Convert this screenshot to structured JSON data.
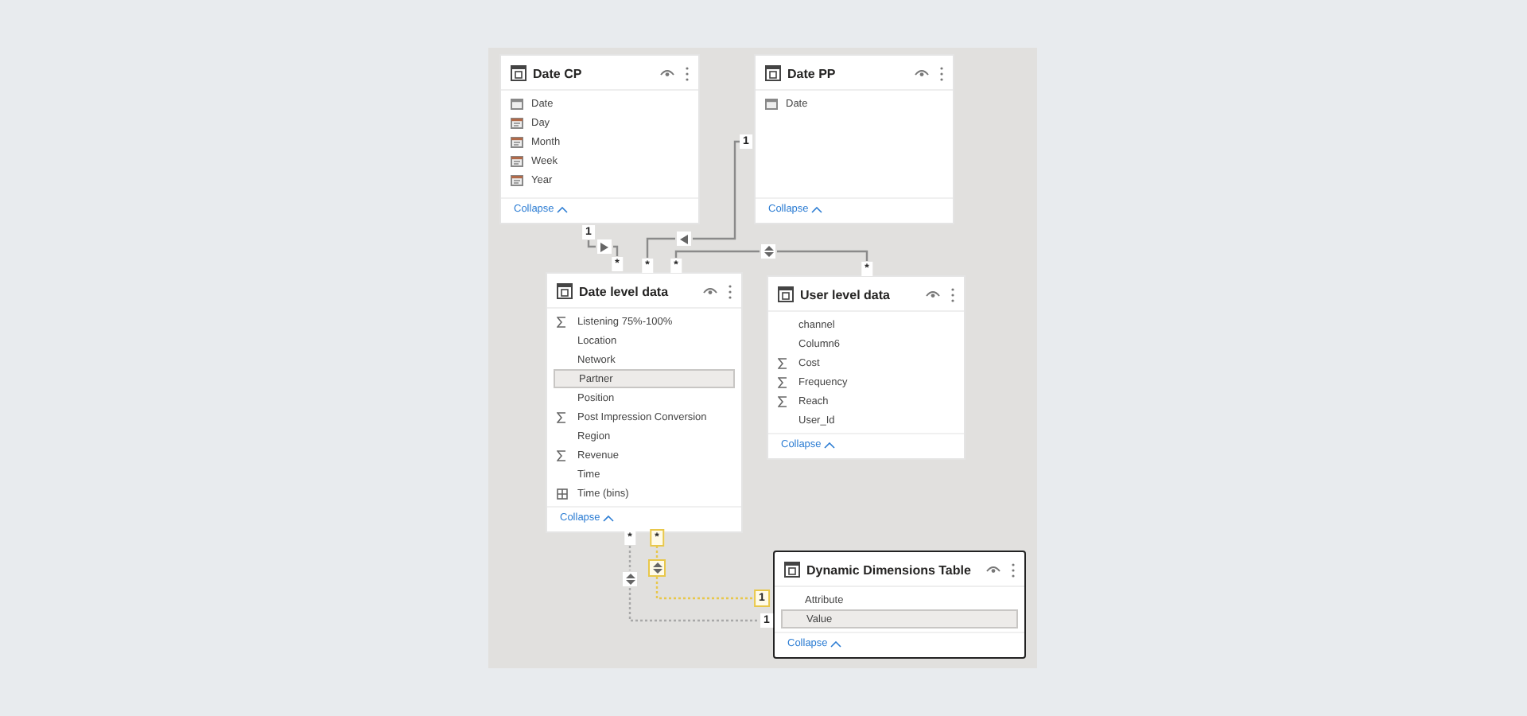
{
  "tables": [
    {
      "title": "Date CP",
      "selected": false,
      "fields": [
        {
          "name": "Date",
          "kind": "date",
          "selected": false
        },
        {
          "name": "Day",
          "kind": "hierarchy",
          "selected": false
        },
        {
          "name": "Month",
          "kind": "hierarchy",
          "selected": false
        },
        {
          "name": "Week",
          "kind": "hierarchy",
          "selected": false
        },
        {
          "name": "Year",
          "kind": "hierarchy",
          "selected": false
        }
      ],
      "collapse": "Collapse"
    },
    {
      "title": "Date PP",
      "selected": false,
      "fields": [
        {
          "name": "Date",
          "kind": "date",
          "selected": false
        }
      ],
      "collapse": "Collapse"
    },
    {
      "title": "Date level data",
      "selected": false,
      "fields": [
        {
          "name": "Listening 75%-100%",
          "kind": "sigma",
          "selected": false
        },
        {
          "name": "Location",
          "kind": "text",
          "selected": false
        },
        {
          "name": "Network",
          "kind": "text",
          "selected": false
        },
        {
          "name": "Partner",
          "kind": "text",
          "selected": true
        },
        {
          "name": "Position",
          "kind": "text",
          "selected": false
        },
        {
          "name": "Post Impression Conversion",
          "kind": "sigma",
          "selected": false
        },
        {
          "name": "Region",
          "kind": "text",
          "selected": false
        },
        {
          "name": "Revenue",
          "kind": "sigma",
          "selected": false
        },
        {
          "name": "Time",
          "kind": "text",
          "selected": false
        },
        {
          "name": "Time (bins)",
          "kind": "grid",
          "selected": false
        }
      ],
      "collapse": "Collapse"
    },
    {
      "title": "User level data",
      "selected": false,
      "fields": [
        {
          "name": "channel",
          "kind": "text",
          "selected": false
        },
        {
          "name": "Column6",
          "kind": "text",
          "selected": false
        },
        {
          "name": "Cost",
          "kind": "sigma",
          "selected": false
        },
        {
          "name": "Frequency",
          "kind": "sigma",
          "selected": false
        },
        {
          "name": "Reach",
          "kind": "sigma",
          "selected": false
        },
        {
          "name": "User_Id",
          "kind": "text",
          "selected": false
        }
      ],
      "collapse": "Collapse"
    },
    {
      "title": "Dynamic Dimensions Table",
      "selected": true,
      "fields": [
        {
          "name": "Attribute",
          "kind": "text",
          "selected": false
        },
        {
          "name": "Value",
          "kind": "text",
          "selected": true
        }
      ],
      "collapse": "Collapse"
    }
  ],
  "relationships": [
    {
      "ends": [
        "1",
        "*"
      ],
      "bidirectional": false,
      "highlighted": false,
      "active": true
    },
    {
      "ends": [
        "1",
        "*"
      ],
      "bidirectional": false,
      "highlighted": false,
      "active": true
    },
    {
      "ends": [
        "*",
        "*"
      ],
      "bidirectional": true,
      "highlighted": false,
      "active": true
    },
    {
      "ends": [
        "*",
        "1"
      ],
      "bidirectional": true,
      "highlighted": false,
      "active": false
    },
    {
      "ends": [
        "*",
        "1"
      ],
      "bidirectional": true,
      "highlighted": true,
      "active": false
    }
  ]
}
